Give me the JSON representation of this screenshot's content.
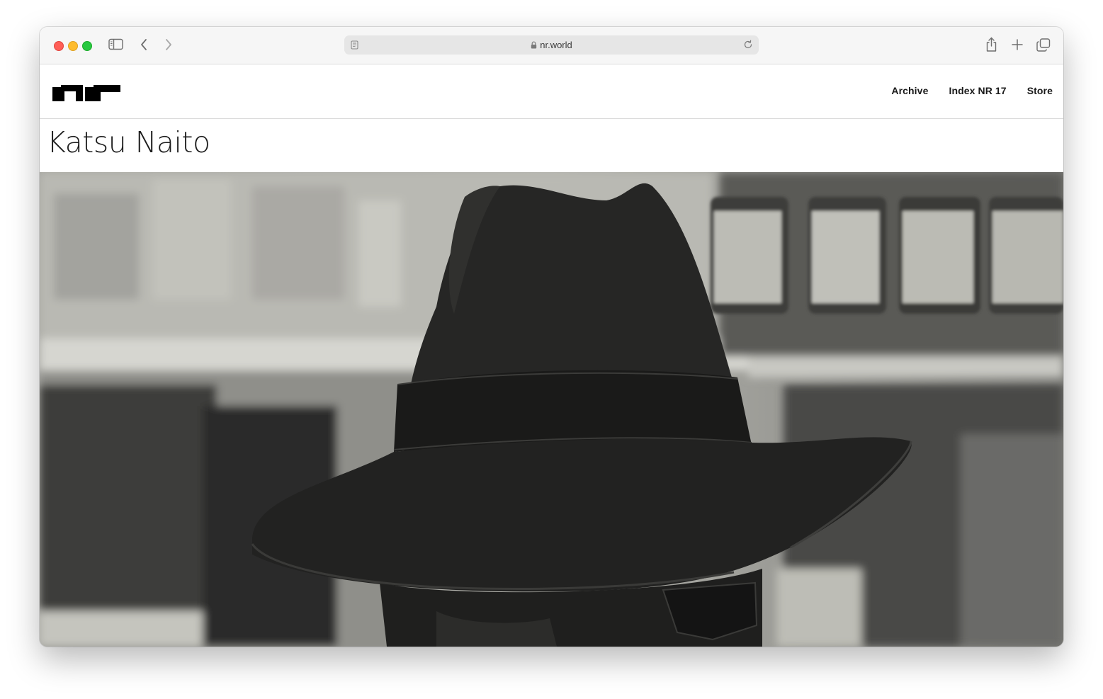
{
  "browser": {
    "url": "nr.world",
    "icons": [
      "sidebar-toggle-icon",
      "back-arrow-icon",
      "forward-arrow-icon",
      "page-icon",
      "lock-icon",
      "reload-icon",
      "share-icon",
      "new-tab-plus-icon",
      "tab-overview-icon"
    ]
  },
  "site": {
    "logo_name": "nr-logo",
    "nav": {
      "archive": "Archive",
      "index": "Index NR 17",
      "store": "Store"
    },
    "title": "Katsu Naito"
  },
  "hero": {
    "description_icon": "photo",
    "colors": {
      "tone": "#9a9a95",
      "hat": "#1d1d1c"
    }
  }
}
